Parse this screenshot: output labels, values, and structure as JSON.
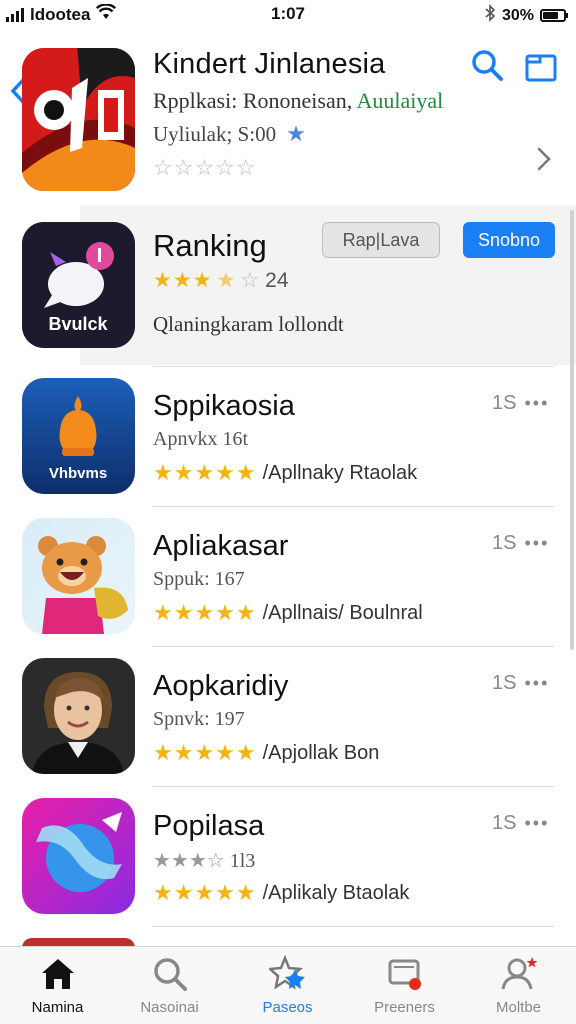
{
  "status_bar": {
    "carrier": "ldootea",
    "time": "1:07",
    "battery": "30%"
  },
  "header": {
    "title": "Kindert Jinlanesia",
    "subtitle_main": "Rpplkasi: Rononeisan,",
    "subtitle_accent": "Auulaiyal",
    "meta": "Uyliulak; S:00"
  },
  "ranking": {
    "title": "Ranking",
    "rating_count": "24",
    "description": "Qlaningkaram lollondt",
    "icon_label": "Bvulck",
    "secondary_button": "Rap|Lava",
    "primary_button": "Snobno"
  },
  "list": [
    {
      "title": "Sppikaosia",
      "subtitle": "Apnvkx 16t",
      "rating_text": "/Apllnaky  Rtaolak",
      "size": "1S",
      "icon_label": "Vhbvms",
      "icon": "bell-icon",
      "stars": 5
    },
    {
      "title": "Apliakasar",
      "subtitle": "Sppuk: 167",
      "rating_text": "/Apllnais/ Boulnral",
      "size": "1S",
      "icon_label": "",
      "icon": "bear-mascot-icon",
      "stars": 5
    },
    {
      "title": "Aopkaridiy",
      "subtitle": "Spnvk: 197",
      "rating_text": "/Apjollak Bon",
      "size": "1S",
      "icon_label": "",
      "icon": "profile-photo",
      "stars": 5
    },
    {
      "title": "Popilasa",
      "subtitle": "1l3",
      "rating_text": "/Aplikaly  Btaolak",
      "size": "1S",
      "icon_label": "",
      "icon": "globe-icon",
      "stars": 5
    }
  ],
  "tabs": [
    {
      "label": "Namina",
      "icon": "home-icon",
      "state": "active"
    },
    {
      "label": "Nasoinai",
      "icon": "search-icon",
      "state": "normal"
    },
    {
      "label": "Paseos",
      "icon": "star-icon",
      "state": "selected"
    },
    {
      "label": "Preeners",
      "icon": "updates-icon",
      "state": "normal"
    },
    {
      "label": "Moltbe",
      "icon": "profile-icon",
      "state": "normal"
    }
  ],
  "colors": {
    "accent": "#1a7ff2",
    "star_gold": "#f3b312",
    "header_icon_red": "#d51a1a"
  }
}
